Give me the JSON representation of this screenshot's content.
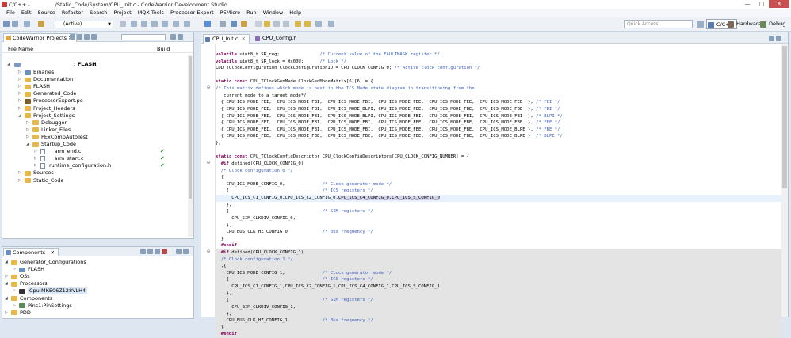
{
  "window": {
    "title": "C/C++ - ",
    "title_tail": "/Static_Code/System/CPU_Init.c - CodeWarrior Development Studio",
    "min": "—",
    "max": "□",
    "close": "✕"
  },
  "menu": [
    "File",
    "Edit",
    "Source",
    "Refactor",
    "Search",
    "Project",
    "MQX Tools",
    "Processor Expert",
    "PEMicro",
    "Run",
    "Window",
    "Help"
  ],
  "toolbar": {
    "config_combo": "(Active)",
    "quick_access_placeholder": "Quick Access",
    "perspectives": [
      "C/C++",
      "Hardware",
      "Debug"
    ]
  },
  "project_panel": {
    "tab": "CodeWarrior Projects",
    "columns": {
      "file_name": "File Name",
      "build": "Build"
    },
    "root": ": FLASH",
    "items": [
      {
        "label": "Binaries",
        "depth": 1,
        "type": "folder-bin"
      },
      {
        "label": "Documentation",
        "depth": 1,
        "type": "folder"
      },
      {
        "label": "FLASH",
        "depth": 1,
        "type": "folder"
      },
      {
        "label": "Generated_Code",
        "depth": 1,
        "type": "folder"
      },
      {
        "label": "ProcessorExpert.pe",
        "depth": 1,
        "type": "pe"
      },
      {
        "label": "Project_Headers",
        "depth": 1,
        "type": "folder"
      },
      {
        "label": "Project_Settings",
        "depth": 1,
        "type": "folder",
        "open": true
      },
      {
        "label": "Debugger",
        "depth": 2,
        "type": "folder"
      },
      {
        "label": "Linker_Files",
        "depth": 2,
        "type": "folder"
      },
      {
        "label": "PExCompAutoTest",
        "depth": 2,
        "type": "folder"
      },
      {
        "label": "Startup_Code",
        "depth": 2,
        "type": "folder",
        "open": true
      },
      {
        "label": "__arm_end.c",
        "depth": 3,
        "type": "file",
        "check": true
      },
      {
        "label": "__arm_start.c",
        "depth": 3,
        "type": "file",
        "check": true
      },
      {
        "label": "runtime_configuration.h",
        "depth": 3,
        "type": "file",
        "check": true
      },
      {
        "label": "Sources",
        "depth": 1,
        "type": "folder"
      },
      {
        "label": "Static_Code",
        "depth": 1,
        "type": "folder"
      }
    ]
  },
  "components_panel": {
    "tab": "Components - ",
    "items": [
      {
        "label": "Generator_Configurations",
        "depth": 0,
        "type": "folder",
        "open": true
      },
      {
        "label": "FLASH",
        "depth": 1,
        "type": "gear"
      },
      {
        "label": "OSs",
        "depth": 0,
        "type": "folder"
      },
      {
        "label": "Processors",
        "depth": 0,
        "type": "folder",
        "open": true
      },
      {
        "label": "Cpu:MKE06Z128VLH4",
        "depth": 1,
        "type": "chip",
        "selected": true
      },
      {
        "label": "Components",
        "depth": 0,
        "type": "folder",
        "open": true
      },
      {
        "label": "Pins1:PinSettings",
        "depth": 1,
        "type": "pin"
      },
      {
        "label": "PDD",
        "depth": 0,
        "type": "folder"
      }
    ]
  },
  "editor": {
    "tabs": [
      {
        "label": "CPU_Init.c",
        "active": true
      },
      {
        "label": "CPU_Config.h",
        "active": false
      }
    ],
    "lines": [
      {
        "t": "volatile uint8_t SR_reg;               /* Current value of the FAULTMASK register */"
      },
      {
        "t": "volatile uint8_t SR_lock = 0x00U;      /* Lock */"
      },
      {
        "t": "LDD_TClockConfiguration ClockConfigurationID = CPU_CLOCK_CONFIG_0; /* Active clock configuration */"
      },
      {
        "t": ""
      },
      {
        "t": "static const CPU_TClockGenMode ClockGenModeMatrix[6][6] = {"
      },
      {
        "t": "/* This matrix defines which mode is next in the ICS Mode state diagram in transitioning from the",
        "fold": "⊖"
      },
      {
        "t": "   current mode to a target mode*/"
      },
      {
        "t": "  { CPU_ICS_MODE_FEI,  CPU_ICS_MODE_FBI,  CPU_ICS_MODE_FBI,  CPU_ICS_MODE_FEE,  CPU_ICS_MODE_FEE,  CPU_ICS_MODE_FEE  }, /* FEI */"
      },
      {
        "t": "  { CPU_ICS_MODE_FEI,  CPU_ICS_MODE_FBI,  CPU_ICS_MODE_BLPI, CPU_ICS_MODE_FEE,  CPU_ICS_MODE_FBE,  CPU_ICS_MODE_FBE  }, /* FBI */"
      },
      {
        "t": "  { CPU_ICS_MODE_FBI,  CPU_ICS_MODE_FBI,  CPU_ICS_MODE_BLPI, CPU_ICS_MODE_FBI,  CPU_ICS_MODE_FBI,  CPU_ICS_MODE_FBI  }, /* BLPI */"
      },
      {
        "t": "  { CPU_ICS_MODE_FEI,  CPU_ICS_MODE_FBI,  CPU_ICS_MODE_FBI,  CPU_ICS_MODE_FEE,  CPU_ICS_MODE_FBE,  CPU_ICS_MODE_FBE  }, /* FEE */"
      },
      {
        "t": "  { CPU_ICS_MODE_FEI,  CPU_ICS_MODE_FBI,  CPU_ICS_MODE_FBI,  CPU_ICS_MODE_FEE,  CPU_ICS_MODE_FBE,  CPU_ICS_MODE_BLPE }, /* FBE */"
      },
      {
        "t": "  { CPU_ICS_MODE_FBE,  CPU_ICS_MODE_FBE,  CPU_ICS_MODE_FBE,  CPU_ICS_MODE_FBE,  CPU_ICS_MODE_FBE,  CPU_ICS_MODE_BLPE }  /* BLPE */"
      },
      {
        "t": "};"
      },
      {
        "t": ""
      },
      {
        "t": "static const CPU_TClockConfigDescriptor CPU_ClockConfigDescriptors[CPU_CLOCK_CONFIG_NUMBER] = {"
      },
      {
        "t": "  #if defined(CPU_CLOCK_CONFIG_0)",
        "fold": "⊖"
      },
      {
        "t": "  /* Clock configuration 0 */"
      },
      {
        "t": "  {"
      },
      {
        "t": "    CPU_ICS_MODE_CONFIG_0,              /* Clock generator mode */"
      },
      {
        "t": "    {                                   /* ICS registers */"
      },
      {
        "t": "      CPU_ICS_C1_CONFIG_0,CPU_ICS_C2_CONFIG_0,CPU_ICS_C4_CONFIG_0,CPU_ICS_S_CONFIG_0",
        "cur": true
      },
      {
        "t": "    },"
      },
      {
        "t": "    {                                   /* SIM registers */"
      },
      {
        "t": "      CPU_SIM_CLKDIV_CONFIG_0,"
      },
      {
        "t": "    },"
      },
      {
        "t": "    CPU_BUS_CLK_HZ_CONFIG_0             /* Bus frequency */"
      },
      {
        "t": "  }"
      },
      {
        "t": "  #endif"
      },
      {
        "t": "  #if defined(CPU_CLOCK_CONFIG_1)",
        "grey": true,
        "fold": "⊖"
      },
      {
        "t": "  /* Clock configuration 1 */",
        "grey": true
      },
      {
        "t": "  ,{",
        "grey": true
      },
      {
        "t": "    CPU_ICS_MODE_CONFIG_1,              /* Clock generator mode */",
        "grey": true
      },
      {
        "t": "    {                                   /* ICS registers */",
        "grey": true
      },
      {
        "t": "      CPU_ICS_C1_CONFIG_1,CPU_ICS_C2_CONFIG_1,CPU_ICS_C4_CONFIG_1,CPU_ICS_S_CONFIG_1",
        "grey": true
      },
      {
        "t": "    },",
        "grey": true
      },
      {
        "t": "    {                                   /* SIM registers */",
        "grey": true
      },
      {
        "t": "      CPU_SIM_CLKDIV_CONFIG_1,",
        "grey": true
      },
      {
        "t": "    },",
        "grey": true
      },
      {
        "t": "    CPU_BUS_CLK_HZ_CONFIG_1             /* Bus frequency */",
        "grey": true
      },
      {
        "t": "  }",
        "grey": true
      },
      {
        "t": "  #endif",
        "grey": true
      }
    ]
  },
  "colors": {
    "folder": "#e6b94a",
    "keyword": "#7f0055",
    "comment": "#3f5fbf",
    "check": "#2a9a2a"
  }
}
